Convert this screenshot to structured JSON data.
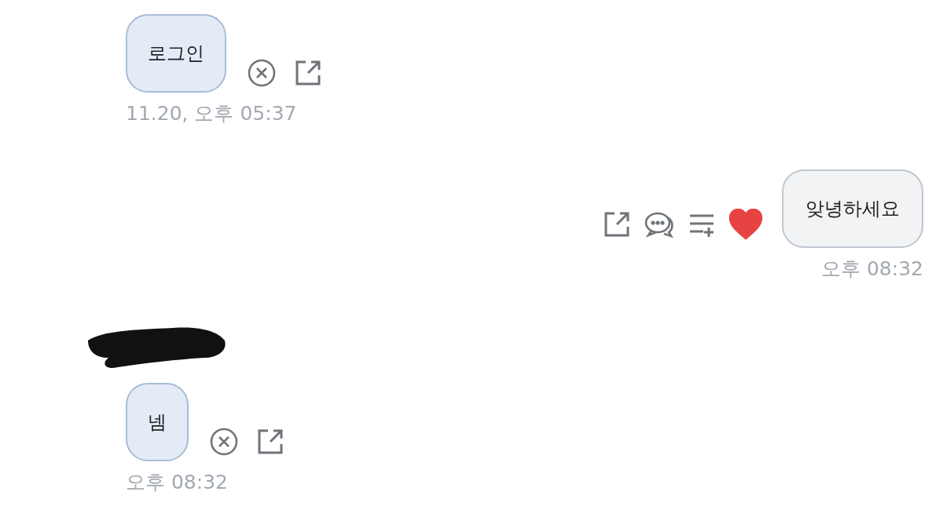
{
  "messages": [
    {
      "kind": "incoming",
      "text": "로그인",
      "time": "11.20, 오후 05:37"
    },
    {
      "kind": "outgoing",
      "text": "앚녕하세요",
      "time": "오후 08:32",
      "liked": true
    },
    {
      "kind": "incoming",
      "text": "넴",
      "time": "오후 08:32",
      "sender_redacted": true
    }
  ]
}
